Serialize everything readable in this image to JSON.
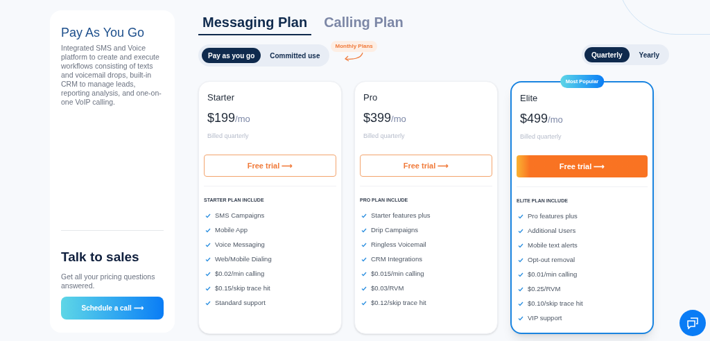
{
  "intro": {
    "title": "Pay As You Go",
    "description": "Integrated SMS and Voice platform to create and execute workflows consisting of texts and voicemail drops, built-in CRM to manage leads, reporting analysis, and one-on-one VoIP calling."
  },
  "sales": {
    "title": "Talk to sales",
    "text": "Get all your pricing questions answered.",
    "button": "Schedule a call ⟶"
  },
  "plan_tabs": [
    {
      "label": "Messaging Plan",
      "selected": true
    },
    {
      "label": "Calling Plan",
      "selected": false
    }
  ],
  "usage_toggle": [
    {
      "label": "Pay as you go",
      "selected": true
    },
    {
      "label": "Committed use",
      "selected": false
    }
  ],
  "annotation": "Monthly Plans",
  "billing_toggle": [
    {
      "label": "Quarterly",
      "selected": true
    },
    {
      "label": "Yearly",
      "selected": false
    }
  ],
  "plans": [
    {
      "name": "Starter",
      "price": "$199",
      "unit": "/mo",
      "billing": "Billed quarterly",
      "button": "Free trial ⟶",
      "featured": false,
      "includes_title": "STARTER PLAN INCLUDE",
      "features": [
        "SMS Campaigns",
        "Mobile App",
        "Voice Messaging",
        "Web/Mobile Dialing",
        "$0.02/min calling",
        "$0.15/skip trace hit",
        "Standard support"
      ]
    },
    {
      "name": "Pro",
      "price": "$399",
      "unit": "/mo",
      "billing": "Billed quarterly",
      "button": "Free trial ⟶",
      "featured": false,
      "includes_title": "PRO PLAN INCLUDE",
      "features": [
        "Starter features plus",
        "Drip Campaigns",
        "Ringless Voicemail",
        "CRM Integrations",
        "$0.015/min calling",
        "$0.03/RVM",
        "$0.12/skip trace hit"
      ]
    },
    {
      "name": "Elite",
      "price": "$499",
      "unit": "/mo",
      "billing": "Billed quarterly",
      "button": "Free trial ⟶",
      "featured": true,
      "badge": "Most Popular",
      "includes_title": "ELITE PLAN INCLUDE",
      "features": [
        "Pro features plus",
        "Additional Users",
        "Mobile text alerts",
        "Opt-out removal",
        "$0.01/min calling",
        "$0.25/RVM",
        "$0.10/skip trace hit",
        "VIP support"
      ]
    }
  ]
}
